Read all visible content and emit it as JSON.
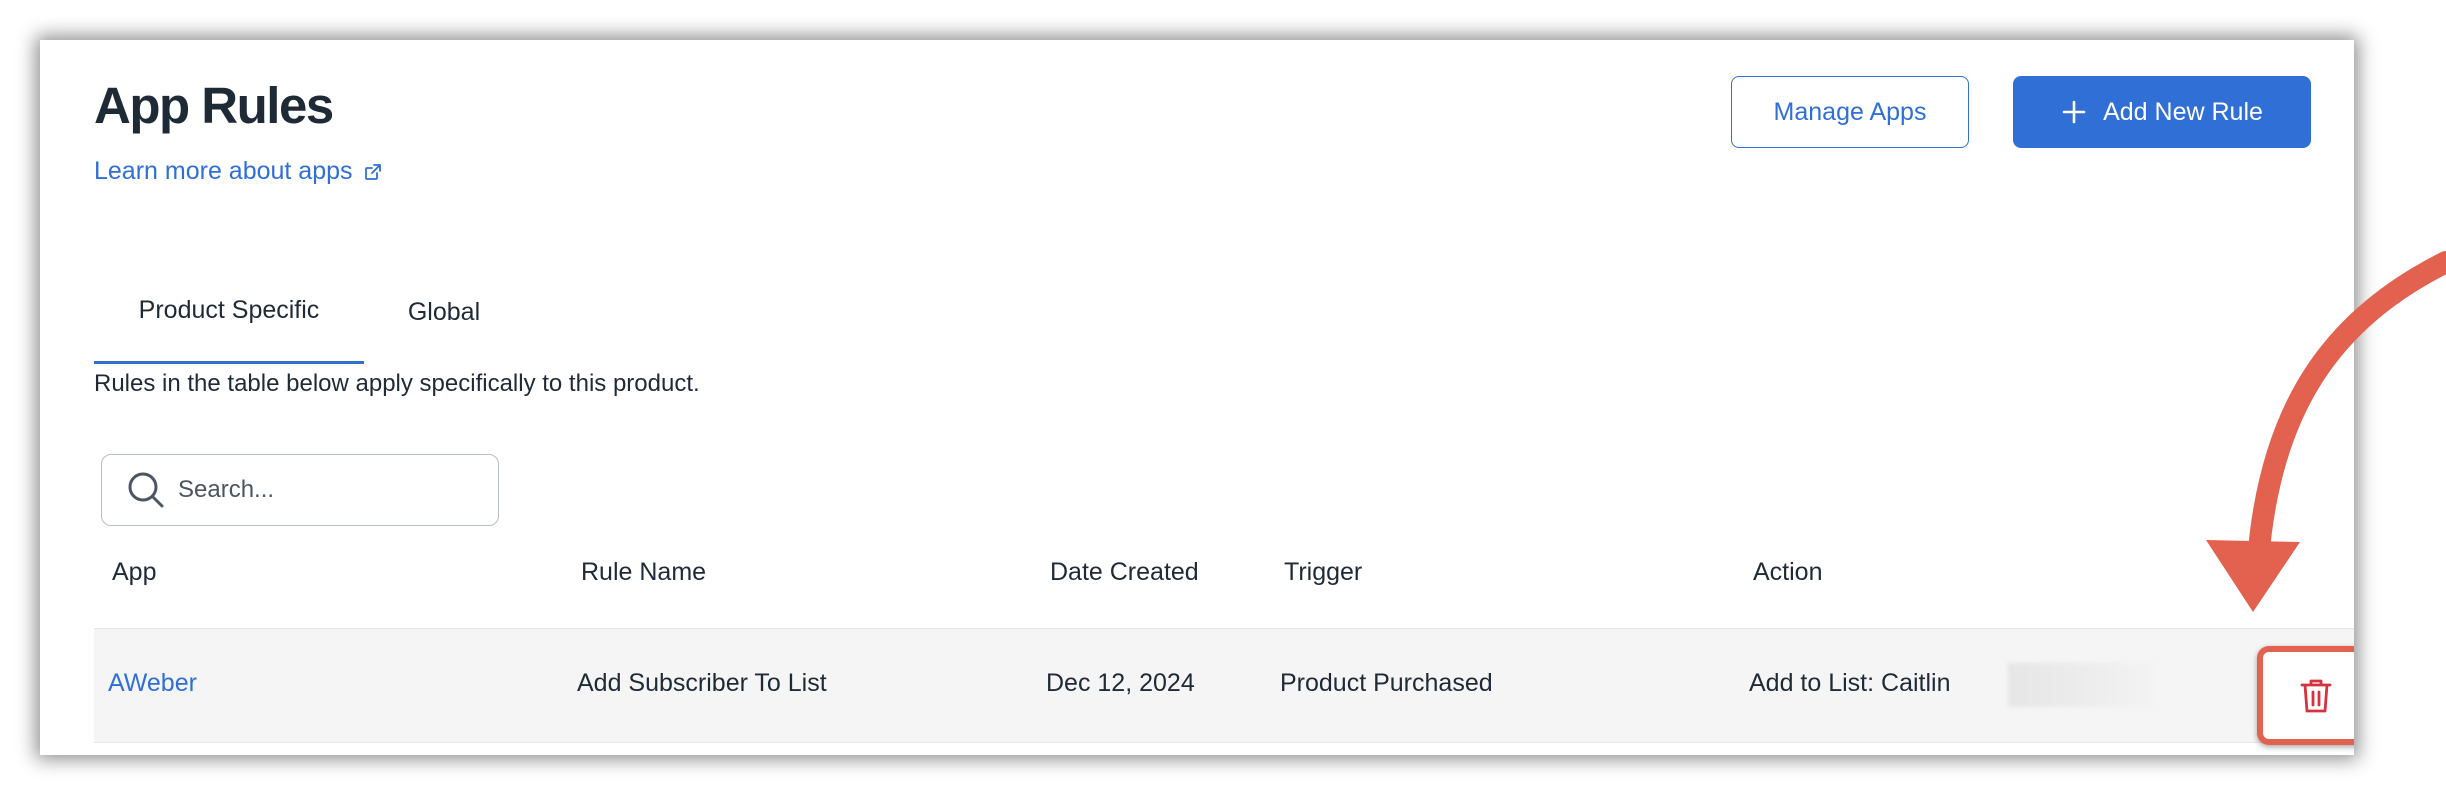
{
  "header": {
    "title": "App Rules",
    "learn_more": "Learn more about apps",
    "manage_apps": "Manage Apps",
    "add_rule": "Add New Rule"
  },
  "tabs": [
    {
      "label": "Product Specific",
      "active": true
    },
    {
      "label": "Global",
      "active": false
    }
  ],
  "description": "Rules in the table below apply specifically to this product.",
  "search": {
    "placeholder": "Search..."
  },
  "table": {
    "columns": [
      "App",
      "Rule Name",
      "Date Created",
      "Trigger",
      "Action"
    ],
    "rows": [
      {
        "app": "AWeber",
        "rule_name": "Add Subscriber To List",
        "date_created": "Dec 12, 2024",
        "trigger": "Product Purchased",
        "action": "Add to List: Caitlin"
      }
    ]
  },
  "colors": {
    "accent": "#2f6fd6",
    "danger": "#d6323f",
    "highlight": "#e2624f"
  }
}
